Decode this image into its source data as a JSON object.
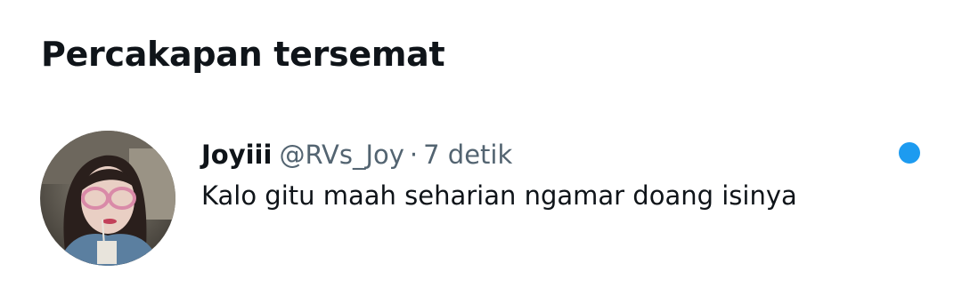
{
  "section": {
    "title": "Percakapan tersemat"
  },
  "conversation": {
    "display_name": "Joyiii",
    "handle": "@RVs_Joy",
    "separator": "·",
    "time": "7 detik",
    "message": "Kalo gitu maah seharian ngamar doang isinya",
    "unread_color": "#1d9bf0",
    "avatar_icon": "user-avatar-photo"
  }
}
